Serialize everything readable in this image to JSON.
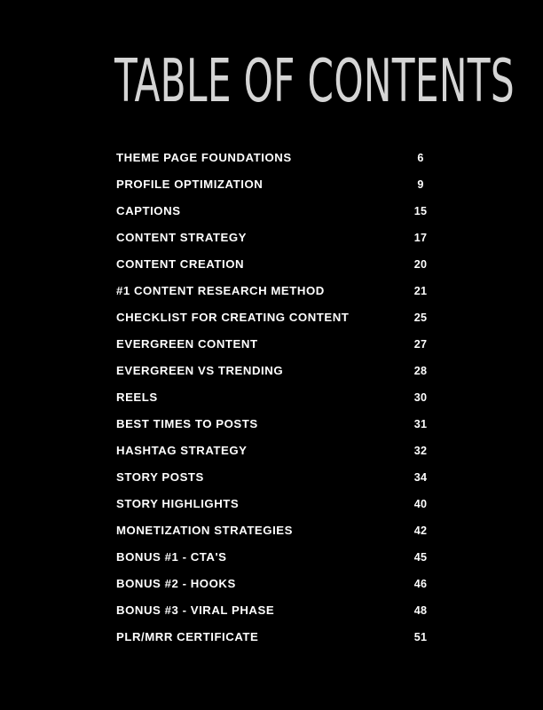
{
  "document": {
    "title": "TABLE OF CONTENTS",
    "background_color": "#000000",
    "title_color": "#d5d5d5",
    "entry_color": "#ffffff"
  },
  "contents": [
    {
      "label": "THEME PAGE FOUNDATIONS",
      "page": "6"
    },
    {
      "label": "PROFILE OPTIMIZATION",
      "page": "9"
    },
    {
      "label": "CAPTIONS",
      "page": "15"
    },
    {
      "label": "CONTENT STRATEGY",
      "page": "17"
    },
    {
      "label": "CONTENT CREATION",
      "page": "20"
    },
    {
      "label": "#1 CONTENT RESEARCH METHOD",
      "page": "21"
    },
    {
      "label": "CHECKLIST FOR CREATING CONTENT",
      "page": "25"
    },
    {
      "label": "EVERGREEN CONTENT",
      "page": "27"
    },
    {
      "label": "EVERGREEN VS TRENDING",
      "page": "28"
    },
    {
      "label": "REELS",
      "page": "30"
    },
    {
      "label": "BEST TIMES TO POSTS",
      "page": "31"
    },
    {
      "label": "HASHTAG STRATEGY",
      "page": "32"
    },
    {
      "label": "STORY POSTS",
      "page": "34"
    },
    {
      "label": "STORY HIGHLIGHTS",
      "page": "40"
    },
    {
      "label": "MONETIZATION STRATEGIES",
      "page": "42"
    },
    {
      "label": "BONUS #1 - CTA'S",
      "page": "45"
    },
    {
      "label": "BONUS #2 - HOOKS",
      "page": "46"
    },
    {
      "label": "BONUS #3 - VIRAL PHASE",
      "page": "48"
    },
    {
      "label": "PLR/MRR CERTIFICATE",
      "page": "51"
    }
  ]
}
